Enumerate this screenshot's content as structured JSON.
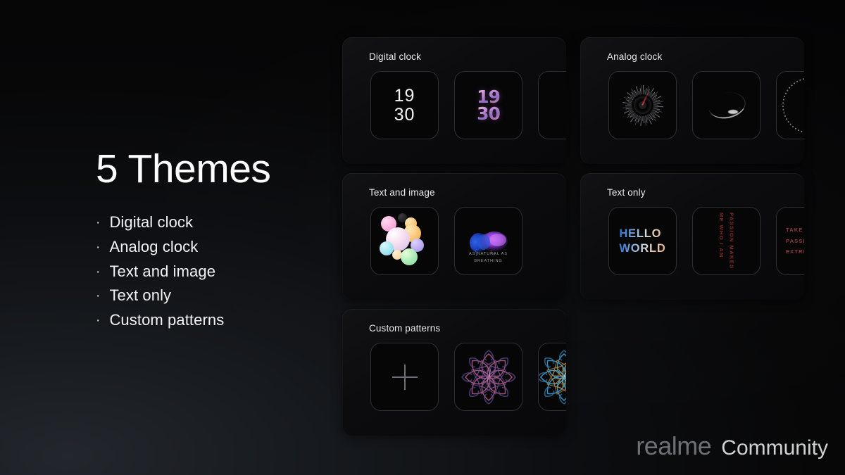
{
  "headline": "5 Themes",
  "bullets": [
    {
      "marker": "·",
      "label": "Digital clock"
    },
    {
      "marker": "·",
      "label": "Analog clock"
    },
    {
      "marker": "·",
      "label": "Text and image"
    },
    {
      "marker": "·",
      "label": "Text only"
    },
    {
      "marker": "·",
      "label": "Custom patterns"
    }
  ],
  "cards": {
    "digital_clock": {
      "title": "Digital clock",
      "tiles": [
        {
          "name": "plain-digital-clock",
          "time_line1": "19",
          "time_line2": "30"
        },
        {
          "name": "3d-gradient-digital-clock",
          "time_line1": "19",
          "time_line2": "30"
        },
        {
          "name": "third-digital-clock-partial"
        }
      ]
    },
    "analog_clock": {
      "title": "Analog clock",
      "tiles": [
        {
          "name": "radial-burst-dial"
        },
        {
          "name": "crescent-dial"
        },
        {
          "name": "dotted-ring-dial-partial"
        }
      ]
    },
    "text_and_image": {
      "title": "Text and image",
      "tiles": [
        {
          "name": "pastel-bubbles-image"
        },
        {
          "name": "jellyfish-image-with-caption",
          "caption_line1": "AS NATURAL AS",
          "caption_line2": "BREATHING"
        }
      ]
    },
    "text_only": {
      "title": "Text only",
      "tiles": [
        {
          "name": "hello-world-text",
          "line1": "HELLO",
          "line2": "WORLD"
        },
        {
          "name": "vertical-passion-text",
          "column1": "PASSION MAKES",
          "column2": "ME WHO I AM"
        },
        {
          "name": "take-passion-text-partial",
          "line1": "TAKE",
          "line2": "PASSI",
          "line3": "EXTRE"
        }
      ]
    },
    "custom_patterns": {
      "title": "Custom patterns",
      "tiles": [
        {
          "name": "add-custom-pattern",
          "glyph": "+"
        },
        {
          "name": "purple-mandala-pattern"
        },
        {
          "name": "blue-orange-mandala-pattern-partial"
        }
      ]
    }
  },
  "footer": {
    "brand": "realme",
    "community": "Community"
  },
  "colors": {
    "background": "#070708",
    "card": "#0c0c0e",
    "tile_border": "#2f2f33",
    "text_primary": "#f2f2f3",
    "accent_purple": "#8e6fc4",
    "accent_red": "#8c2b2b",
    "accent_blue": "#4f90dd"
  }
}
